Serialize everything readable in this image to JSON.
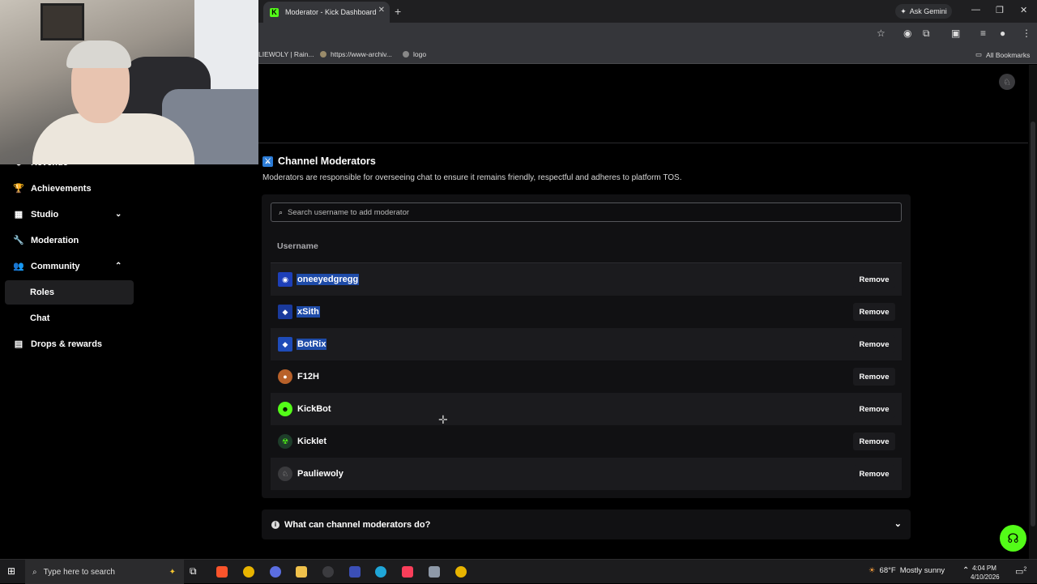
{
  "browser": {
    "tab_title": "Moderator - Kick Dashboard",
    "tab_favicon": "K",
    "ask_gemini": "Ask Gemini",
    "bookmarks": [
      {
        "label": "LIEWOLY | Rain..."
      },
      {
        "label": "https://www-archiv..."
      },
      {
        "label": "logo"
      }
    ],
    "all_bookmarks": "All Bookmarks"
  },
  "sidebar": {
    "items": [
      {
        "label": "Revenue",
        "icon": "revenue-icon"
      },
      {
        "label": "Achievements",
        "icon": "trophy-icon"
      },
      {
        "label": "Studio",
        "icon": "studio-icon",
        "expanded": false
      },
      {
        "label": "Moderation",
        "icon": "wrench-icon"
      },
      {
        "label": "Community",
        "icon": "community-icon",
        "expanded": true
      },
      {
        "label": "Drops & rewards",
        "icon": "drops-icon"
      }
    ],
    "community_sub": [
      {
        "label": "Roles",
        "active": true
      },
      {
        "label": "Chat",
        "active": false
      }
    ]
  },
  "main": {
    "title": "Channel Moderators",
    "description": "Moderators are responsible for overseeing chat to ensure it remains friendly, respectful and adheres to platform TOS.",
    "search_placeholder": "Search username to add moderator",
    "column_username": "Username",
    "remove_label": "Remove",
    "moderators": [
      {
        "name": "oneeyedgregg",
        "selected": true
      },
      {
        "name": "xSith",
        "selected": true
      },
      {
        "name": "BotRix",
        "selected": true
      },
      {
        "name": "F12H",
        "selected": false
      },
      {
        "name": "KickBot",
        "selected": false
      },
      {
        "name": "Kicklet",
        "selected": false
      },
      {
        "name": "Pauliewoly",
        "selected": false
      }
    ],
    "faq_title": "What can channel moderators do?"
  },
  "taskbar": {
    "search_placeholder": "Type here to search",
    "weather_temp": "68°F",
    "weather_text": "Mostly sunny",
    "time": "4:04 PM",
    "date": "4/10/2026",
    "notification_count": "2"
  },
  "colors": {
    "kick_green": "#53fc18",
    "selection_blue": "#1e4ba8",
    "card_bg": "#111113"
  }
}
